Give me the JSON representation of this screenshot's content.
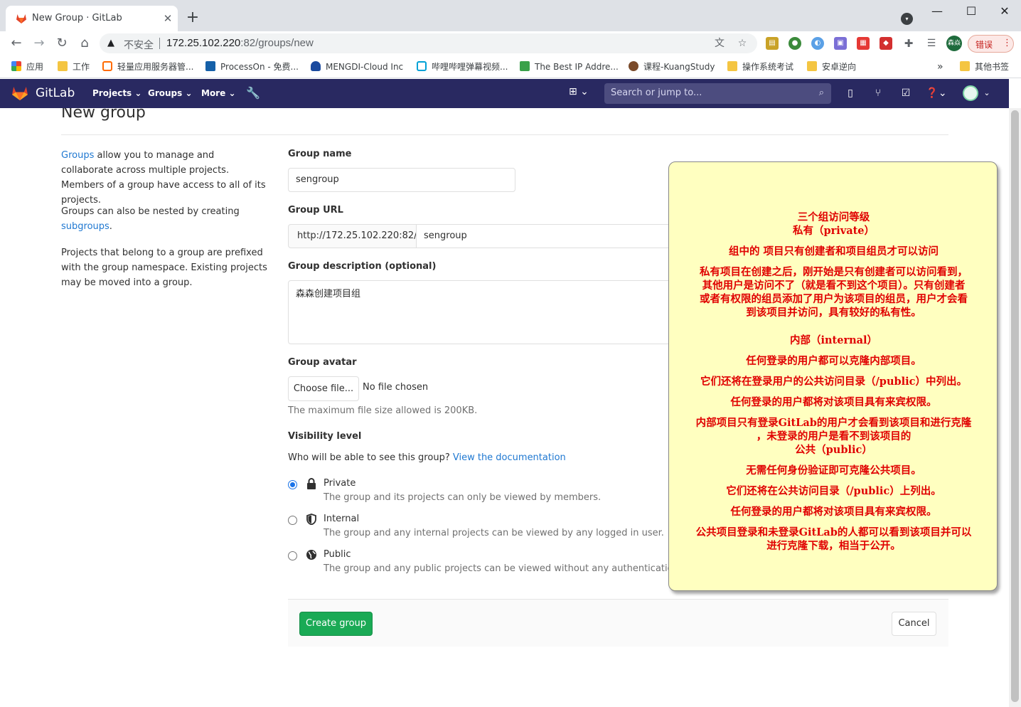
{
  "browser": {
    "tab_title": "New Group · GitLab",
    "omnibox": {
      "security_text": "不安全",
      "url_host": "172.25.102.220",
      "url_rest": ":82/groups/new"
    },
    "profile_avatar_text": "森焱",
    "error_button": "错误",
    "bookmarks": [
      {
        "label": "应用",
        "icon": "apps-grid-icon"
      },
      {
        "label": "工作",
        "icon": "folder-icon"
      },
      {
        "label": "轻量应用服务器管...",
        "icon": "cloud-icon"
      },
      {
        "label": "ProcessOn - 免费...",
        "icon": "processon-icon"
      },
      {
        "label": "MENGDI-Cloud Inc",
        "icon": "cloud-icon"
      },
      {
        "label": "哔哩哔哩弹幕视频...",
        "icon": "bilibili-icon"
      },
      {
        "label": "The Best IP Addre...",
        "icon": "arrow-icon"
      },
      {
        "label": "课程-KuangStudy",
        "icon": "avatar-icon"
      },
      {
        "label": "操作系统考试",
        "icon": "folder-icon"
      },
      {
        "label": "安卓逆向",
        "icon": "folder-icon"
      }
    ],
    "bookmarks_overflow": "»",
    "other_bookmarks": "其他书签"
  },
  "gitlab": {
    "brand": "GitLab",
    "nav": [
      "Projects",
      "Groups",
      "More"
    ],
    "search_placeholder": "Search or jump to..."
  },
  "page": {
    "title": "New group",
    "sidebar": {
      "p1_link": "Groups",
      "p1_rest": " allow you to manage and collaborate across multiple projects. Members of a group have access to all of its projects.",
      "p2_text": "Groups can also be nested by creating ",
      "p2_link": "subgroups",
      "p2_end": ".",
      "p3": "Projects that belong to a group are prefixed with the group namespace. Existing projects may be moved into a group."
    },
    "form": {
      "group_name_label": "Group name",
      "group_name_value": "sengroup",
      "group_url_label": "Group URL",
      "group_url_prefix": "http://172.25.102.220:82/",
      "group_url_value": "sengroup",
      "description_label": "Group description (optional)",
      "description_value": "森森创建项目组",
      "avatar_label": "Group avatar",
      "choose_file": "Choose file...",
      "no_file": "No file chosen",
      "file_help": "The maximum file size allowed is 200KB.",
      "visibility_label": "Visibility level",
      "visibility_question": "Who will be able to see this group?",
      "visibility_doc_link": "View the documentation",
      "options": [
        {
          "title": "Private",
          "desc": "The group and its projects can only be viewed by members.",
          "checked": true,
          "icon": "lock-icon"
        },
        {
          "title": "Internal",
          "desc": "The group and any internal projects can be viewed by any logged in user.",
          "checked": false,
          "icon": "shield-icon"
        },
        {
          "title": "Public",
          "desc": "The group and any public projects can be viewed without any authentication.",
          "checked": false,
          "icon": "globe-icon"
        }
      ],
      "create_button": "Create group",
      "cancel_button": "Cancel"
    }
  },
  "note": {
    "lines": [
      "三个组访问等级",
      "私有（private）",
      "组中的 项目只有创建者和项目组员才可以访问",
      "私有项目在创建之后，刚开始是只有创建者可以访问看到，",
      "其他用户是访问不了（就是看不到这个项目）。只有创建者",
      "或者有权限的组员添加了用户为该项目的组员，用户才会看",
      "到该项目并访问，具有较好的私有性。",
      "内部（internal）",
      "任何登录的用户都可以克隆内部项目。",
      "它们还将在登录用户的公共访问目录（/public）中列出。",
      "任何登录的用户都将对该项目具有来宾权限。",
      "内部项目只有登录GitLab的用户才会看到该项目和进行克隆",
      "，未登录的用户是看不到该项目的",
      "公共（public）",
      "无需任何身份验证即可克隆公共项目。",
      "它们还将在公共访问目录（/public）上列出。",
      "任何登录的用户都将对该项目具有来宾权限。",
      "公共项目登录和未登录GitLab的人都可以看到该项目并可以",
      "进行克隆下载，相当于公开。"
    ]
  }
}
